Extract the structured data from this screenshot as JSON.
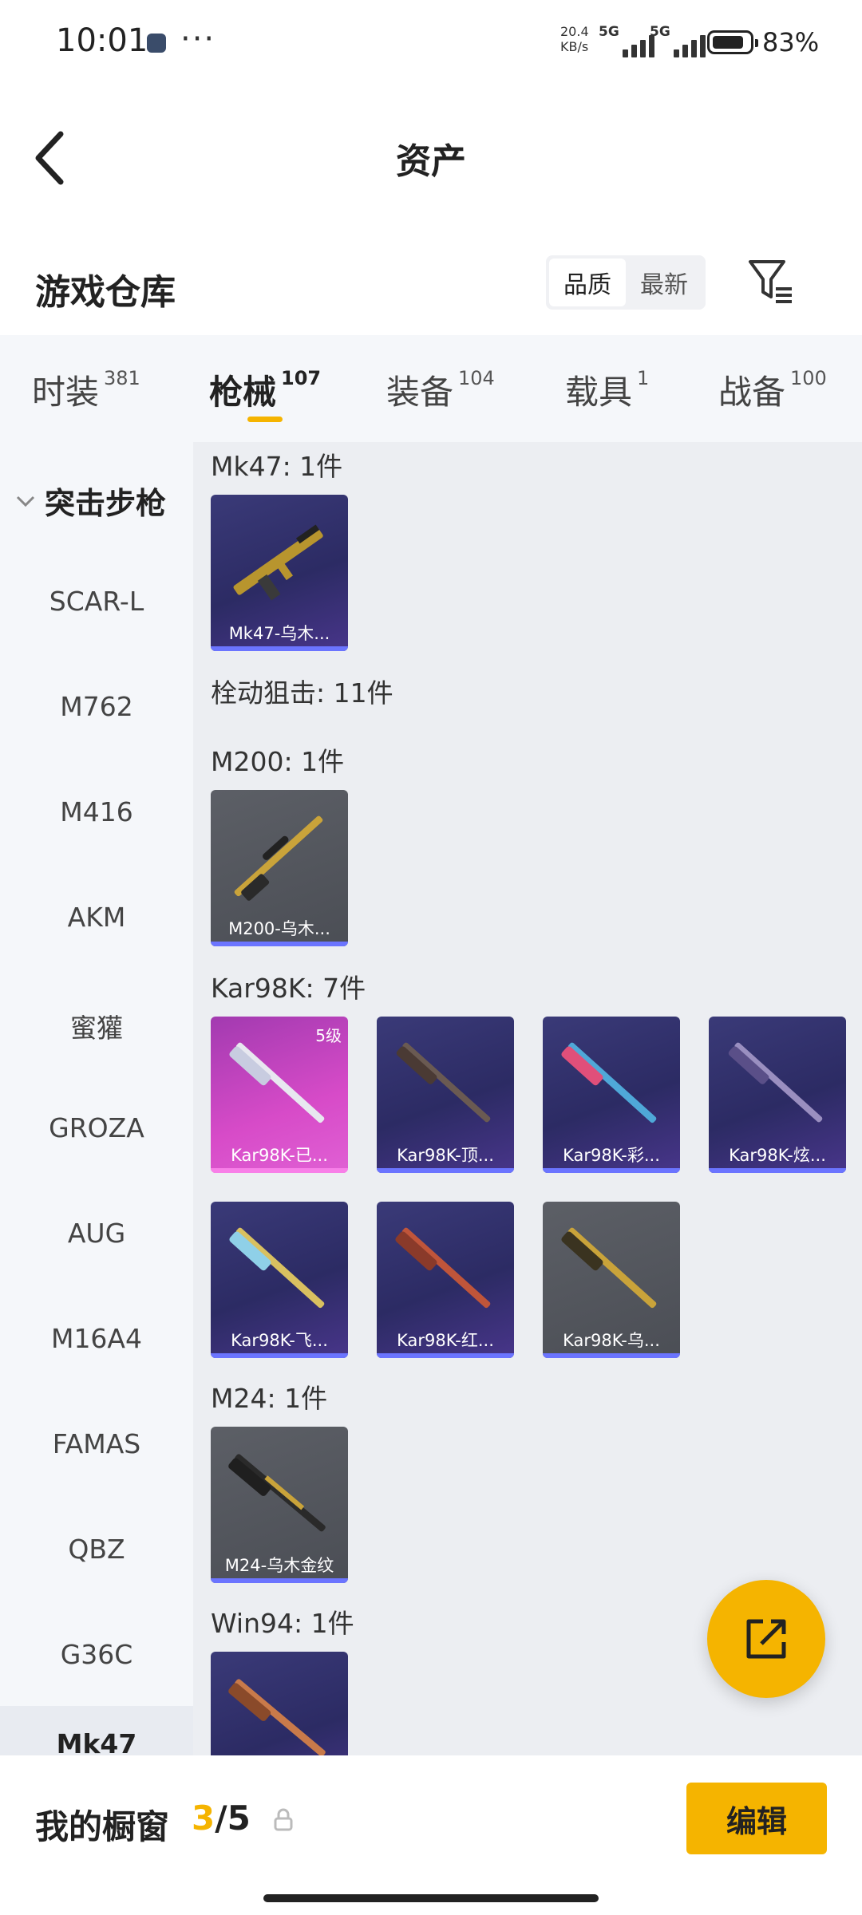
{
  "status_bar": {
    "time": "10:01",
    "net_speed_value": "20.4",
    "net_speed_unit": "KB/s",
    "sim1": "5G",
    "sim2": "5G",
    "battery": "83%",
    "more": "···"
  },
  "nav": {
    "title": "资产",
    "back_icon": "back-chevron-icon"
  },
  "warehouse": {
    "title": "游戏仓库",
    "sort_options": [
      "品质",
      "最新"
    ],
    "sort_selected": "品质",
    "filter_icon": "filter-icon"
  },
  "tabs": [
    {
      "label": "时装",
      "count": "381"
    },
    {
      "label": "枪械",
      "count": "107"
    },
    {
      "label": "装备",
      "count": "104"
    },
    {
      "label": "载具",
      "count": "1"
    },
    {
      "label": "战备",
      "count": "100"
    }
  ],
  "active_tab": "枪械",
  "sidebar": {
    "header": "突击步枪",
    "items": [
      "SCAR-L",
      "M762",
      "M416",
      "AKM",
      "蜜獾",
      "GROZA",
      "AUG",
      "M16A4",
      "FAMAS",
      "QBZ",
      "G36C"
    ],
    "bottom_item": "Mk47"
  },
  "groups": {
    "mk47": {
      "title": "Mk47: 1件",
      "items": [
        {
          "name": "Mk47-乌木...",
          "rarity": "purple"
        }
      ]
    },
    "bolt_action": {
      "title": "栓动狙击: 11件"
    },
    "m200": {
      "title": "M200: 1件",
      "items": [
        {
          "name": "M200-乌木...",
          "rarity": "grey"
        }
      ]
    },
    "kar98k": {
      "title": "Kar98K: 7件",
      "items": [
        {
          "name": "Kar98K-已...",
          "rarity": "pink",
          "level": "5级"
        },
        {
          "name": "Kar98K-顶...",
          "rarity": "purple"
        },
        {
          "name": "Kar98K-彩...",
          "rarity": "purple"
        },
        {
          "name": "Kar98K-炫...",
          "rarity": "purple"
        },
        {
          "name": "Kar98K-飞...",
          "rarity": "purple"
        },
        {
          "name": "Kar98K-红...",
          "rarity": "purple"
        },
        {
          "name": "Kar98K-乌...",
          "rarity": "grey"
        }
      ]
    },
    "m24": {
      "title": "M24: 1件",
      "items": [
        {
          "name": "M24-乌木金纹",
          "rarity": "grey"
        }
      ]
    },
    "win94": {
      "title": "Win94: 1件",
      "items": [
        {
          "name": "",
          "rarity": "purple"
        }
      ]
    }
  },
  "fab_icon": "share-external-icon",
  "bottom": {
    "title": "我的橱窗",
    "current": "3",
    "separator": "/",
    "total": "5",
    "lock_icon": "lock-icon",
    "edit_label": "编辑"
  },
  "colors": {
    "accent": "#f5b400",
    "rarity_purple": "#6b74ff",
    "rarity_pink": "#f87fe8"
  }
}
